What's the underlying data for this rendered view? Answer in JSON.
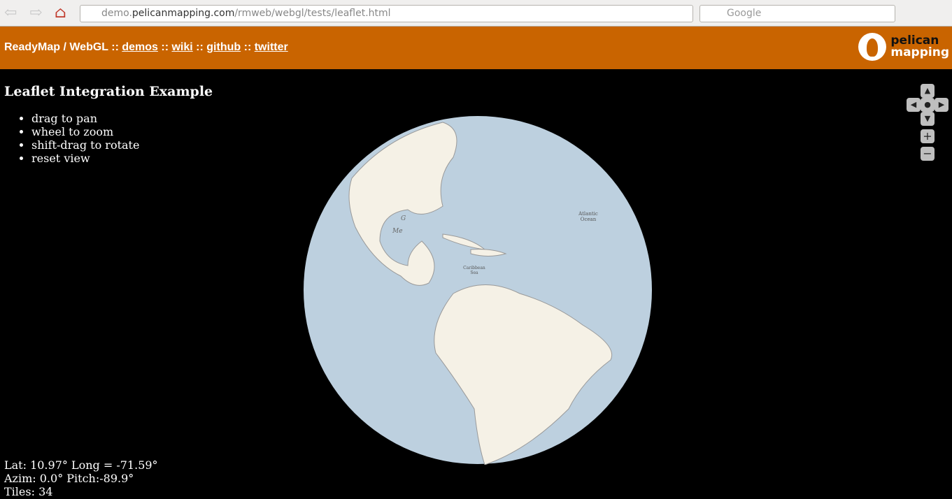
{
  "browser": {
    "url_host": "demo.pelicanmapping.com",
    "url_prefix": "demo.",
    "url_domain": "pelicanmapping.com",
    "url_path": "/rmweb/webgl/tests/leaflet.html",
    "search_placeholder": "Google"
  },
  "header": {
    "title": "ReadyMap / WebGL",
    "sep": "::",
    "links": [
      "demos",
      "wiki",
      "github",
      "twitter"
    ],
    "logo_line1": "pelican",
    "logo_line2": "mapping"
  },
  "page": {
    "title_link": "Leaflet",
    "title_rest": " Integration Example",
    "instructions": [
      "drag to pan",
      "wheel to zoom",
      "shift-drag to rotate"
    ],
    "reset": "reset view"
  },
  "map": {
    "labels": {
      "atlantic1": "Atlantic",
      "atlantic2": "Ocean",
      "caribbean1": "Caribbean",
      "caribbean2": "Sea",
      "gulf1": "G",
      "gulf2": "Me"
    },
    "ocean_color": "#bdd0df",
    "land_color": "#f5f1e6"
  },
  "status": {
    "latlong": "Lat: 10.97° Long = -71.59°",
    "azim": "Azim: 0.0° Pitch:-89.9°",
    "tiles": "Tiles: 34"
  }
}
